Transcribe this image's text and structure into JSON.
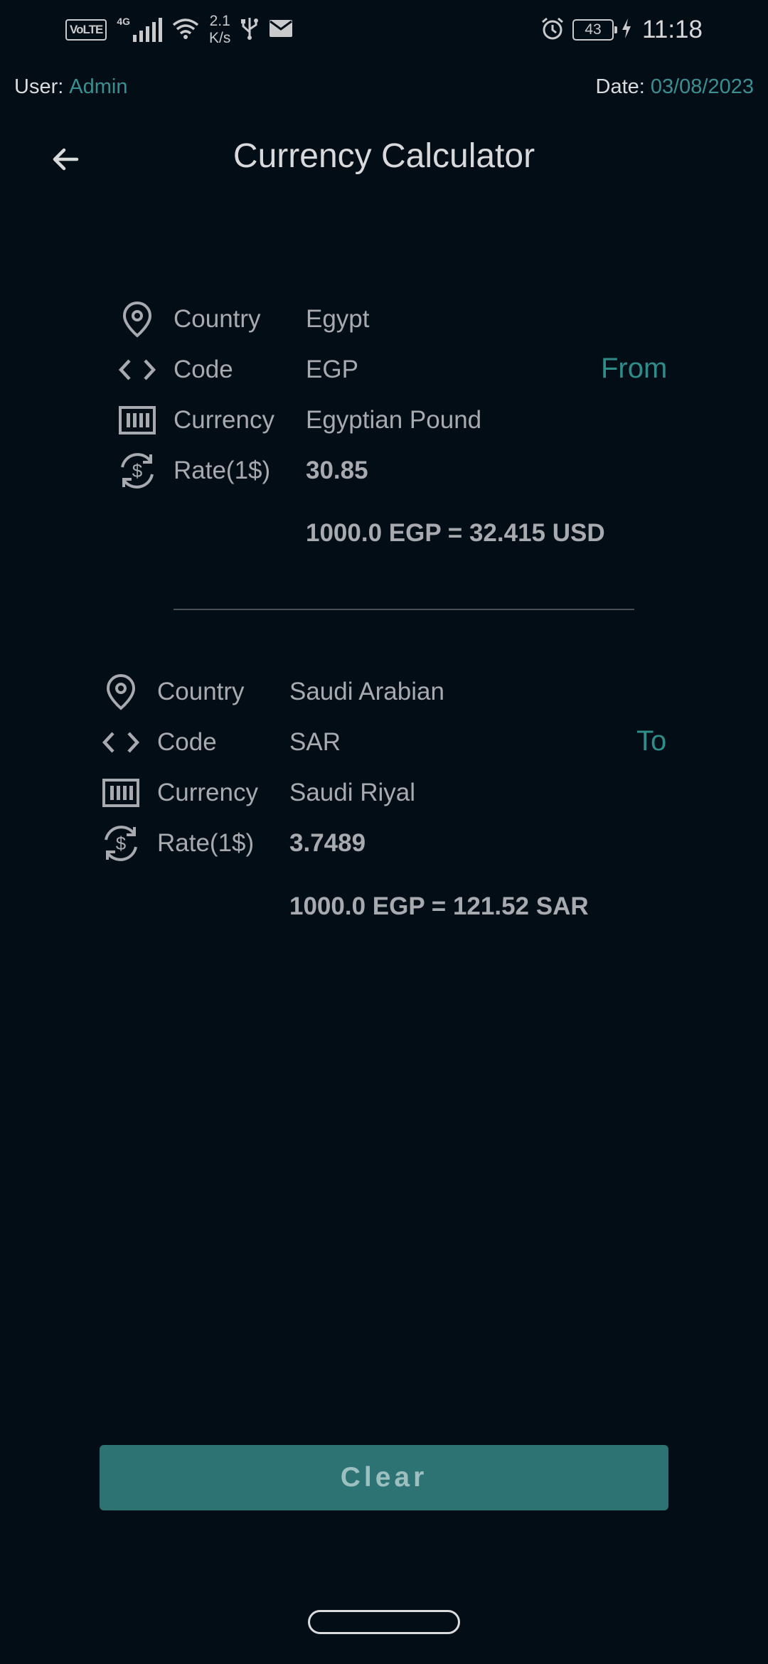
{
  "status": {
    "volte": "VoLTE",
    "network": "4G",
    "speed_value": "2.1",
    "speed_unit": "K/s",
    "battery": "43",
    "time": "11:18"
  },
  "header": {
    "user_label": "User:",
    "user_value": "Admin",
    "date_label": "Date:",
    "date_value": "03/08/2023"
  },
  "app_bar": {
    "title": "Currency Calculator"
  },
  "from": {
    "direction": "From",
    "country_label": "Country",
    "country_value": "Egypt",
    "code_label": "Code",
    "code_value": "EGP",
    "currency_label": "Currency",
    "currency_value": "Egyptian Pound",
    "rate_label": "Rate(1$)",
    "rate_value": "30.85",
    "result": "1000.0 EGP = 32.415 USD"
  },
  "to": {
    "direction": "To",
    "country_label": "Country",
    "country_value": "Saudi Arabian",
    "code_label": "Code",
    "code_value": "SAR",
    "currency_label": "Currency",
    "currency_value": "Saudi Riyal",
    "rate_label": "Rate(1$)",
    "rate_value": "3.7489",
    "result": "1000.0 EGP = 121.52 SAR"
  },
  "actions": {
    "clear_label": "Clear"
  },
  "colors": {
    "background": "#030d16",
    "accent": "#2f8c88",
    "button": "#2e7373"
  },
  "icons": [
    "location-pin-icon",
    "code-brackets-icon",
    "barcode-icon",
    "currency-exchange-icon",
    "back-arrow-icon"
  ]
}
